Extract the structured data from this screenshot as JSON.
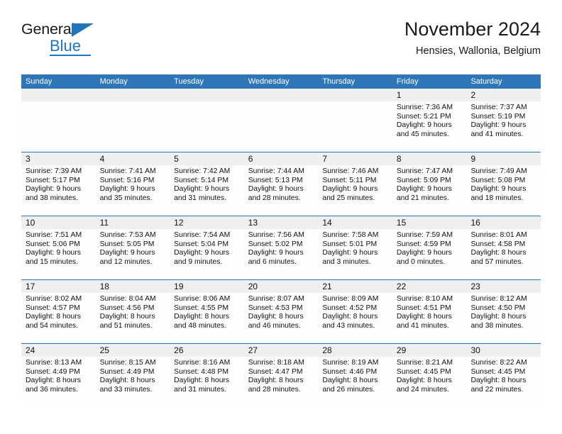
{
  "brand": {
    "name_top": "General",
    "name_bottom": "Blue",
    "accent_color": "#2175bb",
    "flag_icon": "triangle-flag-icon"
  },
  "header": {
    "title": "November 2024",
    "subtitle": "Hensies, Wallonia, Belgium"
  },
  "calendar": {
    "header_bg": "#2e76b8",
    "daynum_band_bg": "#efefef",
    "weekday_headers": [
      "Sunday",
      "Monday",
      "Tuesday",
      "Wednesday",
      "Thursday",
      "Friday",
      "Saturday"
    ],
    "weeks": [
      [
        {
          "day": "",
          "empty": true
        },
        {
          "day": "",
          "empty": true
        },
        {
          "day": "",
          "empty": true
        },
        {
          "day": "",
          "empty": true
        },
        {
          "day": "",
          "empty": true
        },
        {
          "day": "1",
          "sunrise": "Sunrise: 7:36 AM",
          "sunset": "Sunset: 5:21 PM",
          "daylight1": "Daylight: 9 hours",
          "daylight2": "and 45 minutes."
        },
        {
          "day": "2",
          "sunrise": "Sunrise: 7:37 AM",
          "sunset": "Sunset: 5:19 PM",
          "daylight1": "Daylight: 9 hours",
          "daylight2": "and 41 minutes."
        }
      ],
      [
        {
          "day": "3",
          "sunrise": "Sunrise: 7:39 AM",
          "sunset": "Sunset: 5:17 PM",
          "daylight1": "Daylight: 9 hours",
          "daylight2": "and 38 minutes."
        },
        {
          "day": "4",
          "sunrise": "Sunrise: 7:41 AM",
          "sunset": "Sunset: 5:16 PM",
          "daylight1": "Daylight: 9 hours",
          "daylight2": "and 35 minutes."
        },
        {
          "day": "5",
          "sunrise": "Sunrise: 7:42 AM",
          "sunset": "Sunset: 5:14 PM",
          "daylight1": "Daylight: 9 hours",
          "daylight2": "and 31 minutes."
        },
        {
          "day": "6",
          "sunrise": "Sunrise: 7:44 AM",
          "sunset": "Sunset: 5:13 PM",
          "daylight1": "Daylight: 9 hours",
          "daylight2": "and 28 minutes."
        },
        {
          "day": "7",
          "sunrise": "Sunrise: 7:46 AM",
          "sunset": "Sunset: 5:11 PM",
          "daylight1": "Daylight: 9 hours",
          "daylight2": "and 25 minutes."
        },
        {
          "day": "8",
          "sunrise": "Sunrise: 7:47 AM",
          "sunset": "Sunset: 5:09 PM",
          "daylight1": "Daylight: 9 hours",
          "daylight2": "and 21 minutes."
        },
        {
          "day": "9",
          "sunrise": "Sunrise: 7:49 AM",
          "sunset": "Sunset: 5:08 PM",
          "daylight1": "Daylight: 9 hours",
          "daylight2": "and 18 minutes."
        }
      ],
      [
        {
          "day": "10",
          "sunrise": "Sunrise: 7:51 AM",
          "sunset": "Sunset: 5:06 PM",
          "daylight1": "Daylight: 9 hours",
          "daylight2": "and 15 minutes."
        },
        {
          "day": "11",
          "sunrise": "Sunrise: 7:53 AM",
          "sunset": "Sunset: 5:05 PM",
          "daylight1": "Daylight: 9 hours",
          "daylight2": "and 12 minutes."
        },
        {
          "day": "12",
          "sunrise": "Sunrise: 7:54 AM",
          "sunset": "Sunset: 5:04 PM",
          "daylight1": "Daylight: 9 hours",
          "daylight2": "and 9 minutes."
        },
        {
          "day": "13",
          "sunrise": "Sunrise: 7:56 AM",
          "sunset": "Sunset: 5:02 PM",
          "daylight1": "Daylight: 9 hours",
          "daylight2": "and 6 minutes."
        },
        {
          "day": "14",
          "sunrise": "Sunrise: 7:58 AM",
          "sunset": "Sunset: 5:01 PM",
          "daylight1": "Daylight: 9 hours",
          "daylight2": "and 3 minutes."
        },
        {
          "day": "15",
          "sunrise": "Sunrise: 7:59 AM",
          "sunset": "Sunset: 4:59 PM",
          "daylight1": "Daylight: 9 hours",
          "daylight2": "and 0 minutes."
        },
        {
          "day": "16",
          "sunrise": "Sunrise: 8:01 AM",
          "sunset": "Sunset: 4:58 PM",
          "daylight1": "Daylight: 8 hours",
          "daylight2": "and 57 minutes."
        }
      ],
      [
        {
          "day": "17",
          "sunrise": "Sunrise: 8:02 AM",
          "sunset": "Sunset: 4:57 PM",
          "daylight1": "Daylight: 8 hours",
          "daylight2": "and 54 minutes."
        },
        {
          "day": "18",
          "sunrise": "Sunrise: 8:04 AM",
          "sunset": "Sunset: 4:56 PM",
          "daylight1": "Daylight: 8 hours",
          "daylight2": "and 51 minutes."
        },
        {
          "day": "19",
          "sunrise": "Sunrise: 8:06 AM",
          "sunset": "Sunset: 4:55 PM",
          "daylight1": "Daylight: 8 hours",
          "daylight2": "and 48 minutes."
        },
        {
          "day": "20",
          "sunrise": "Sunrise: 8:07 AM",
          "sunset": "Sunset: 4:53 PM",
          "daylight1": "Daylight: 8 hours",
          "daylight2": "and 46 minutes."
        },
        {
          "day": "21",
          "sunrise": "Sunrise: 8:09 AM",
          "sunset": "Sunset: 4:52 PM",
          "daylight1": "Daylight: 8 hours",
          "daylight2": "and 43 minutes."
        },
        {
          "day": "22",
          "sunrise": "Sunrise: 8:10 AM",
          "sunset": "Sunset: 4:51 PM",
          "daylight1": "Daylight: 8 hours",
          "daylight2": "and 41 minutes."
        },
        {
          "day": "23",
          "sunrise": "Sunrise: 8:12 AM",
          "sunset": "Sunset: 4:50 PM",
          "daylight1": "Daylight: 8 hours",
          "daylight2": "and 38 minutes."
        }
      ],
      [
        {
          "day": "24",
          "sunrise": "Sunrise: 8:13 AM",
          "sunset": "Sunset: 4:49 PM",
          "daylight1": "Daylight: 8 hours",
          "daylight2": "and 36 minutes."
        },
        {
          "day": "25",
          "sunrise": "Sunrise: 8:15 AM",
          "sunset": "Sunset: 4:49 PM",
          "daylight1": "Daylight: 8 hours",
          "daylight2": "and 33 minutes."
        },
        {
          "day": "26",
          "sunrise": "Sunrise: 8:16 AM",
          "sunset": "Sunset: 4:48 PM",
          "daylight1": "Daylight: 8 hours",
          "daylight2": "and 31 minutes."
        },
        {
          "day": "27",
          "sunrise": "Sunrise: 8:18 AM",
          "sunset": "Sunset: 4:47 PM",
          "daylight1": "Daylight: 8 hours",
          "daylight2": "and 28 minutes."
        },
        {
          "day": "28",
          "sunrise": "Sunrise: 8:19 AM",
          "sunset": "Sunset: 4:46 PM",
          "daylight1": "Daylight: 8 hours",
          "daylight2": "and 26 minutes."
        },
        {
          "day": "29",
          "sunrise": "Sunrise: 8:21 AM",
          "sunset": "Sunset: 4:45 PM",
          "daylight1": "Daylight: 8 hours",
          "daylight2": "and 24 minutes."
        },
        {
          "day": "30",
          "sunrise": "Sunrise: 8:22 AM",
          "sunset": "Sunset: 4:45 PM",
          "daylight1": "Daylight: 8 hours",
          "daylight2": "and 22 minutes."
        }
      ]
    ]
  }
}
